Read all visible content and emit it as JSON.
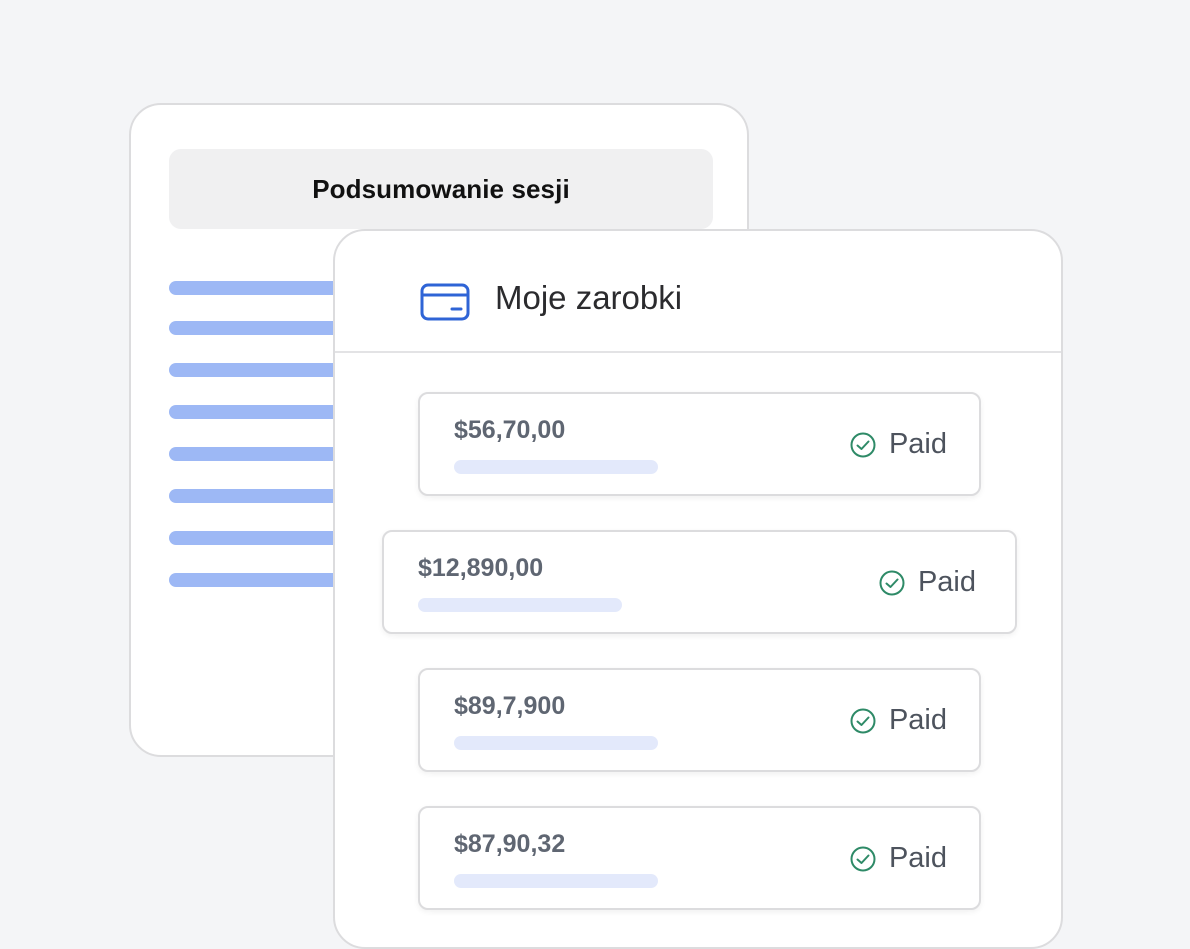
{
  "summary": {
    "title": "Podsumowanie sesji"
  },
  "earnings": {
    "title": "Moje zarobki",
    "icon": "credit-card-icon",
    "accent_color": "#2f64d6",
    "items": [
      {
        "amount": "$56,70,00",
        "status": "Paid"
      },
      {
        "amount": "$12,890,00",
        "status": "Paid"
      },
      {
        "amount": "$89,7,900",
        "status": "Paid"
      },
      {
        "amount": "$87,90,32",
        "status": "Paid"
      }
    ],
    "status_color": "#2e8a67"
  }
}
